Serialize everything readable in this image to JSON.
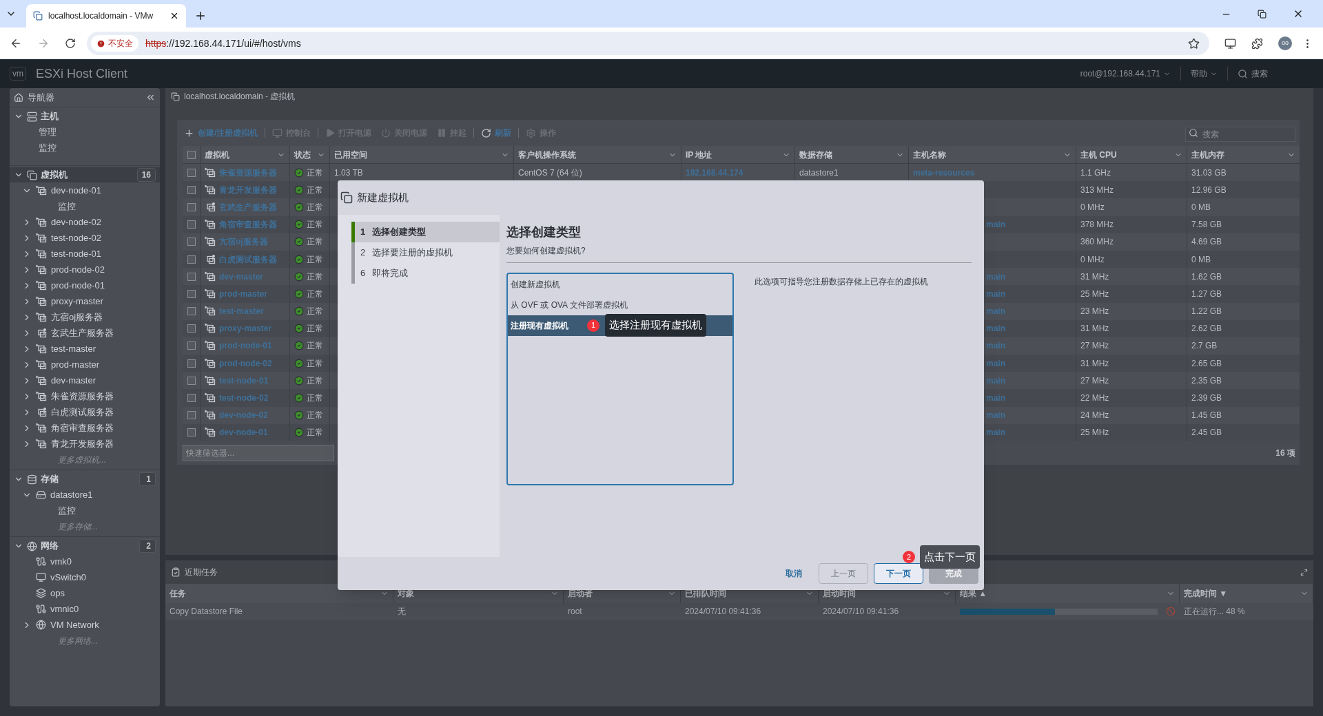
{
  "browser": {
    "tab_title": "localhost.localdomain - VMw",
    "security": "不安全",
    "url_scheme": "https",
    "url_rest": "://192.168.44.171/ui/#/host/vms",
    "profile": "oo"
  },
  "app_header": {
    "brand": "vm",
    "title": "ESXi Host Client",
    "user": "root@192.168.44.171",
    "help": "帮助",
    "search": "搜索"
  },
  "navigator": {
    "title": "导航器",
    "sections": [
      {
        "label": "主机",
        "kind": "host",
        "selected": false,
        "expanded": true,
        "children": [
          {
            "label": "管理",
            "kind": "leaf"
          },
          {
            "label": "监控",
            "kind": "leaf"
          }
        ]
      },
      {
        "label": "虚拟机",
        "kind": "vms",
        "selected": true,
        "expanded": true,
        "count": "16",
        "children": [
          {
            "label": "dev-node-01",
            "kind": "vm",
            "powered_on": true,
            "expanded": true,
            "children": [
              {
                "label": "监控",
                "kind": "leaf"
              }
            ]
          },
          {
            "label": "dev-node-02",
            "kind": "vm",
            "powered_on": true,
            "expanded": false
          },
          {
            "label": "test-node-02",
            "kind": "vm",
            "powered_on": true,
            "expanded": false
          },
          {
            "label": "test-node-01",
            "kind": "vm",
            "powered_on": true,
            "expanded": false
          },
          {
            "label": "prod-node-02",
            "kind": "vm",
            "powered_on": true,
            "expanded": false
          },
          {
            "label": "prod-node-01",
            "kind": "vm",
            "powered_on": true,
            "expanded": false
          },
          {
            "label": "proxy-master",
            "kind": "vm",
            "powered_on": true,
            "expanded": false
          },
          {
            "label": "亢宿oj服务器",
            "kind": "vm",
            "powered_on": true,
            "expanded": false
          },
          {
            "label": "玄武生产服务器",
            "kind": "vm",
            "powered_on": false,
            "expanded": false
          },
          {
            "label": "test-master",
            "kind": "vm",
            "powered_on": true,
            "expanded": false
          },
          {
            "label": "prod-master",
            "kind": "vm",
            "powered_on": true,
            "expanded": false
          },
          {
            "label": "dev-master",
            "kind": "vm",
            "powered_on": true,
            "expanded": false
          },
          {
            "label": "朱雀资源服务器",
            "kind": "vm",
            "powered_on": true,
            "expanded": false
          },
          {
            "label": "白虎测试服务器",
            "kind": "vm",
            "powered_on": false,
            "expanded": false
          },
          {
            "label": "角宿审查服务器",
            "kind": "vm",
            "powered_on": true,
            "expanded": false
          },
          {
            "label": "青龙开发服务器",
            "kind": "vm",
            "powered_on": true,
            "expanded": false
          },
          {
            "label": "更多虚拟机...",
            "kind": "more"
          }
        ]
      },
      {
        "label": "存储",
        "kind": "storage",
        "selected": false,
        "expanded": true,
        "count": "1",
        "children": [
          {
            "label": "datastore1",
            "kind": "datastore",
            "expanded": true,
            "children": [
              {
                "label": "监控",
                "kind": "leaf"
              }
            ]
          },
          {
            "label": "更多存储...",
            "kind": "more"
          }
        ]
      },
      {
        "label": "网络",
        "kind": "network",
        "selected": false,
        "expanded": true,
        "count": "2",
        "children": [
          {
            "label": "vmk0",
            "kind": "nic"
          },
          {
            "label": "vSwitch0",
            "kind": "switch"
          },
          {
            "label": "ops",
            "kind": "portgroup"
          },
          {
            "label": "vmnic0",
            "kind": "nic"
          },
          {
            "label": "VM Network",
            "kind": "network_item",
            "expanded": false
          },
          {
            "label": "更多网络...",
            "kind": "more"
          }
        ]
      }
    ]
  },
  "main": {
    "title": "localhost.localdomain - 虚拟机",
    "toolbar": [
      {
        "label": "创建/注册虚拟机",
        "kind": "create",
        "disabled": false
      },
      {
        "label": "控制台",
        "kind": "console",
        "disabled": true
      },
      {
        "label": "打开电源",
        "kind": "power_on",
        "disabled": true
      },
      {
        "label": "关闭电源",
        "kind": "power_off",
        "disabled": true
      },
      {
        "label": "挂起",
        "kind": "suspend",
        "disabled": true
      },
      {
        "label": "刷新",
        "kind": "refresh",
        "disabled": false
      },
      {
        "label": "操作",
        "kind": "actions",
        "disabled": true
      }
    ],
    "search": {
      "placeholder": "搜索"
    },
    "table": {
      "select_all_checked": false,
      "columns": [
        "虚拟机",
        "状态",
        "已用空间",
        "客户机操作系统",
        "IP 地址",
        "数据存储",
        "主机名称",
        "主机 CPU",
        "主机内存"
      ],
      "rows": [
        {
          "checked": false,
          "name": "朱雀资源服务器",
          "powered_on": true,
          "status": "正常",
          "used": "1.03 TB",
          "os": "CentOS 7 (64 位)",
          "ip": "192.168.44.174",
          "datastore": "datastore1",
          "host": "meta-resources",
          "cpu": "1.1 GHz",
          "memory": "31.03 GB"
        },
        {
          "checked": false,
          "name": "青龙开发服务器",
          "powered_on": true,
          "status": "正常",
          "cpu": "313 MHz",
          "memory": "12.96 GB"
        },
        {
          "checked": false,
          "name": "玄武生产服务器",
          "powered_on": false,
          "status": "正常",
          "cpu": "0 MHz",
          "memory": "0 MB"
        },
        {
          "checked": false,
          "name": "角宿审查服务器",
          "powered_on": true,
          "status": "正常",
          "host": "main",
          "cpu": "378 MHz",
          "memory": "7.58 GB"
        },
        {
          "checked": false,
          "name": "亢宿oj服务器",
          "powered_on": true,
          "status": "正常",
          "cpu": "360 MHz",
          "memory": "4.69 GB"
        },
        {
          "checked": false,
          "name": "白虎测试服务器",
          "powered_on": false,
          "status": "正常",
          "cpu": "0 MHz",
          "memory": "0 MB"
        },
        {
          "checked": false,
          "name": "dev-master",
          "powered_on": true,
          "status": "正常",
          "host": "main",
          "cpu": "31 MHz",
          "memory": "1.62 GB"
        },
        {
          "checked": false,
          "name": "prod-master",
          "powered_on": true,
          "status": "正常",
          "host": "main",
          "cpu": "25 MHz",
          "memory": "1.27 GB"
        },
        {
          "checked": false,
          "name": "test-master",
          "powered_on": true,
          "status": "正常",
          "host": "main",
          "cpu": "23 MHz",
          "memory": "1.22 GB"
        },
        {
          "checked": false,
          "name": "proxy-master",
          "powered_on": true,
          "status": "正常",
          "host": "main",
          "cpu": "31 MHz",
          "memory": "2.62 GB"
        },
        {
          "checked": false,
          "name": "prod-node-01",
          "powered_on": true,
          "status": "正常",
          "host": "main",
          "cpu": "27 MHz",
          "memory": "2.7 GB"
        },
        {
          "checked": false,
          "name": "prod-node-02",
          "powered_on": true,
          "status": "正常",
          "host": "main",
          "cpu": "31 MHz",
          "memory": "2.65 GB"
        },
        {
          "checked": false,
          "name": "test-node-01",
          "powered_on": true,
          "status": "正常",
          "host": "main",
          "cpu": "27 MHz",
          "memory": "2.35 GB"
        },
        {
          "checked": false,
          "name": "test-node-02",
          "powered_on": true,
          "status": "正常",
          "host": "main",
          "cpu": "22 MHz",
          "memory": "2.39 GB"
        },
        {
          "checked": false,
          "name": "dev-node-02",
          "powered_on": true,
          "status": "正常",
          "host": "main",
          "cpu": "24 MHz",
          "memory": "1.45 GB"
        },
        {
          "checked": false,
          "name": "dev-node-01",
          "powered_on": true,
          "status": "正常",
          "host": "main",
          "cpu": "25 MHz",
          "memory": "2.45 GB"
        }
      ]
    },
    "filter": {
      "placeholder": "快速筛选器..."
    },
    "item_count": "16 项"
  },
  "tasks": {
    "title": "近期任务",
    "columns": [
      "任务",
      "对象",
      "启动者",
      "已排队时间",
      "启动时间",
      "结果 ▲",
      "完成时间 ▼"
    ],
    "rows": [
      {
        "task": "Copy Datastore File",
        "target": "无",
        "initiator": "root",
        "queued": "2024/07/10 09:41:36",
        "started": "2024/07/10 09:41:36",
        "level": 0.48,
        "completed": "正在运行... 48 %"
      }
    ]
  },
  "dialog": {
    "title": "新建虚拟机",
    "steps": [
      {
        "number": "1",
        "label": "选择创建类型",
        "selected": true
      },
      {
        "number": "2",
        "label": "选择要注册的虚拟机",
        "selected": false
      },
      {
        "number": "6",
        "label": "即将完成",
        "selected": false
      }
    ],
    "heading": "选择创建类型",
    "subheading": "您要如何创建虚拟机?",
    "options": [
      {
        "label": "创建新虚拟机",
        "selected": false
      },
      {
        "label": "从 OVF 或 OVA 文件部署虚拟机",
        "selected": false
      },
      {
        "label": "注册现有虚拟机",
        "selected": true
      }
    ],
    "description": "此选项可指导您注册数据存储上已存在的虚拟机",
    "buttons": [
      {
        "label": "取消",
        "kind": "link",
        "disabled": false
      },
      {
        "label": "上一页",
        "kind": "secondary",
        "disabled": true
      },
      {
        "label": "下一页",
        "kind": "primary",
        "disabled": false
      },
      {
        "label": "完成",
        "kind": "finish",
        "disabled": true
      }
    ],
    "annotations": [
      {
        "number": "1",
        "text": "选择注册现有虚拟机"
      },
      {
        "number": "2",
        "text": "点击下一页"
      }
    ]
  }
}
